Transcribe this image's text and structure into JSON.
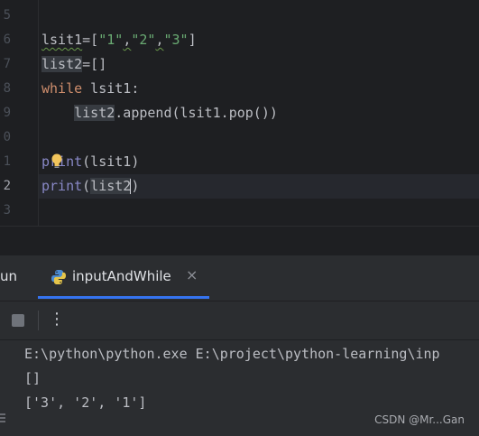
{
  "editor": {
    "gutter_numbers": [
      "5",
      "6",
      "7",
      "8",
      "9",
      "0",
      "1",
      "2",
      "3"
    ],
    "lines": [
      {
        "tokens": []
      },
      {
        "tokens": [
          {
            "t": "lsit1",
            "c": "warn"
          },
          {
            "t": "=[",
            "c": ""
          },
          {
            "t": "\"1\"",
            "c": "str"
          },
          {
            "t": ",",
            "c": "warn"
          },
          {
            "t": "\"2\"",
            "c": "str"
          },
          {
            "t": ",",
            "c": "warn"
          },
          {
            "t": "\"3\"",
            "c": "str"
          },
          {
            "t": "]",
            "c": ""
          }
        ]
      },
      {
        "tokens": [
          {
            "t": "list2",
            "c": "hl"
          },
          {
            "t": "=[]",
            "c": ""
          }
        ]
      },
      {
        "tokens": [
          {
            "t": "while",
            "c": "kw"
          },
          {
            "t": " lsit1:",
            "c": ""
          }
        ]
      },
      {
        "tokens": [
          {
            "t": "    ",
            "c": ""
          },
          {
            "t": "list2",
            "c": "hl"
          },
          {
            "t": ".append(lsit1.pop())",
            "c": ""
          }
        ]
      },
      {
        "tokens": []
      },
      {
        "tokens": [
          {
            "t": "print",
            "c": "fn"
          },
          {
            "t": "(lsit1)",
            "c": ""
          }
        ]
      },
      {
        "tokens": [
          {
            "t": "print",
            "c": "fn"
          },
          {
            "t": "(",
            "c": ""
          },
          {
            "t": "list2",
            "c": "hl"
          },
          {
            "t": ")",
            "c": ""
          }
        ]
      },
      {
        "tokens": []
      }
    ]
  },
  "run": {
    "title": "un",
    "tab_label": "inputAndWhile",
    "tab_close": "×",
    "more_label": "⋮"
  },
  "console": {
    "lines": [
      "E:\\python\\python.exe E:\\project\\python-learning\\inp",
      "[]",
      "['3', '2', '1']"
    ]
  },
  "watermark": "CSDN @Mr...Gan",
  "colors": {
    "accent": "#3574f0",
    "keyword": "#cf8e6d",
    "string": "#6aab73",
    "builtin": "#8888c6",
    "text": "#bcbec4"
  }
}
